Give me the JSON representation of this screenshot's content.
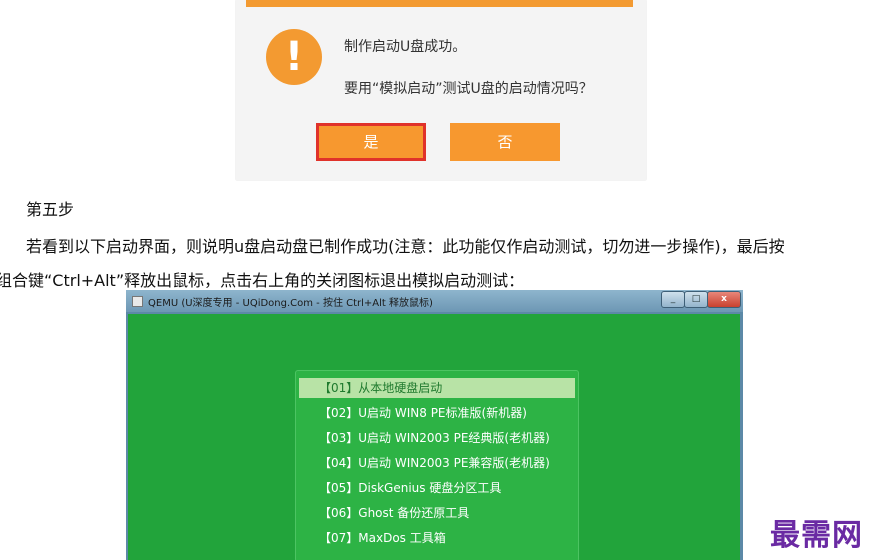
{
  "dialog": {
    "icon": "exclamation-icon",
    "message1": "制作启动U盘成功。",
    "message2": "要用“模拟启动”测试U盘的启动情况吗？",
    "yes_label": "是",
    "no_label": "否",
    "accent_color": "#f39a31",
    "highlight_border_color": "#e0322a"
  },
  "step_title": "第五步",
  "paragraph": {
    "line1": "若看到以下启动界面，则说明u盘启动盘已制作成功(注意：此功能仅作启动测试，切勿进一步操作)，最后按",
    "line2": "组合键“Ctrl+Alt”释放出鼠标，点击右上角的关闭图标退出模拟启动测试："
  },
  "qemu": {
    "title": "QEMU (U深度专用 - UQiDong.Com - 按住 Ctrl+Alt 释放鼠标)",
    "min_glyph": "_",
    "max_glyph": "□",
    "close_glyph": "x",
    "screen_color": "#22a43b",
    "menu_items": [
      {
        "label": "【01】从本地硬盘启动",
        "selected": true
      },
      {
        "label": "【02】U启动 WIN8 PE标准版(新机器)",
        "selected": false
      },
      {
        "label": "【03】U启动 WIN2003 PE经典版(老机器)",
        "selected": false
      },
      {
        "label": "【04】U启动 WIN2003 PE兼容版(老机器)",
        "selected": false
      },
      {
        "label": "【05】DiskGenius 硬盘分区工具",
        "selected": false
      },
      {
        "label": "【06】Ghost 备份还原工具",
        "selected": false
      },
      {
        "label": "【07】MaxDos 工具箱",
        "selected": false
      }
    ]
  },
  "watermark": "最需网"
}
